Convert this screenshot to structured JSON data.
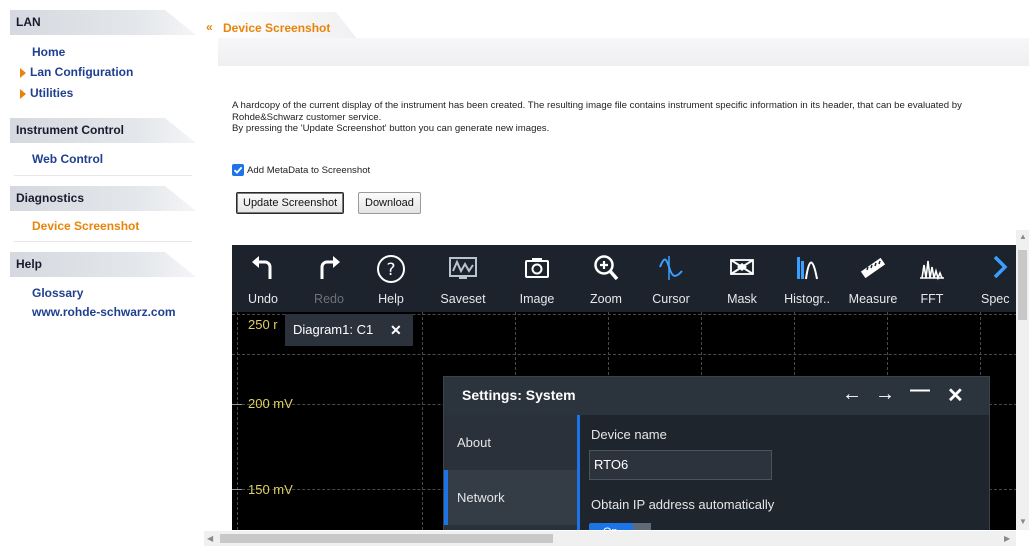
{
  "sidebar": {
    "lan_header": "LAN",
    "lan_items": [
      {
        "label": "Home"
      },
      {
        "label": "Lan Configuration"
      },
      {
        "label": "Utilities"
      }
    ],
    "instrument_header": "Instrument Control",
    "instrument_items": [
      {
        "label": "Web Control"
      }
    ],
    "diagnostics_header": "Diagnostics",
    "diagnostics_items": [
      {
        "label": "Device Screenshot"
      }
    ],
    "help_header": "Help",
    "help_items": [
      {
        "label": "Glossary"
      },
      {
        "label": "www.rohde-schwarz.com"
      }
    ]
  },
  "header": {
    "title": "Device Screenshot"
  },
  "main": {
    "description_line1": "A hardcopy of the current display of the instrument has been created. The resulting image file contains instrument specific information in its header, that can be evaluated by Rohde&Schwarz customer service.",
    "description_line2": "By pressing the 'Update Screenshot' button you can generate new images.",
    "metadata_checkbox_label": "Add MetaData to Screenshot",
    "metadata_checked": true,
    "update_button": "Update Screenshot",
    "download_button": "Download"
  },
  "screenshot": {
    "toolbar": [
      {
        "label": "Undo",
        "icon": "undo-icon"
      },
      {
        "label": "Redo",
        "icon": "redo-icon",
        "disabled": true
      },
      {
        "label": "Help",
        "icon": "help-icon"
      },
      {
        "label": "Saveset",
        "icon": "saveset-icon"
      },
      {
        "label": "Image",
        "icon": "camera-icon"
      },
      {
        "label": "Zoom",
        "icon": "zoom-icon"
      },
      {
        "label": "Cursor",
        "icon": "cursor-icon"
      },
      {
        "label": "Mask",
        "icon": "mask-icon"
      },
      {
        "label": "Histogr..",
        "icon": "histogram-icon"
      },
      {
        "label": "Measure",
        "icon": "measure-icon"
      },
      {
        "label": "FFT",
        "icon": "fft-icon"
      },
      {
        "label": "Spec",
        "icon": "spectrum-icon"
      }
    ],
    "diagram_tab": "Diagram1: C1",
    "voltage_labels": [
      "250 r",
      "200 mV",
      "150 mV"
    ],
    "dialog": {
      "title": "Settings: System",
      "nav": [
        "About",
        "Network"
      ],
      "selected_nav": "Network",
      "device_name_label": "Device name",
      "device_name_value": "RTO6",
      "ip_auto_label": "Obtain IP address automatically",
      "toggle_text": "On"
    }
  },
  "colors": {
    "accent_orange": "#e8840a",
    "link_blue": "#1f3f8f",
    "rs_blue": "#1d74e6",
    "scope_toolbar": "#1c232c",
    "trace_label": "#e0d060"
  }
}
